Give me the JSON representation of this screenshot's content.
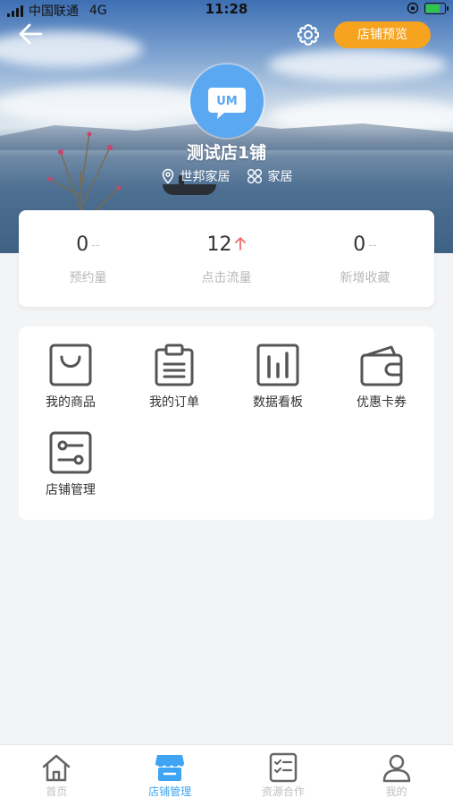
{
  "status_bar": {
    "carrier": "中国联通",
    "network": "4G",
    "time": "11:28",
    "battery_level": 0.85
  },
  "header": {
    "back_icon": "back-arrow-icon",
    "settings_icon": "gear-icon",
    "preview_button_label": "店铺预览",
    "accent_color": "#f6a31f"
  },
  "store": {
    "avatar_text": "UM",
    "name": "测试店1铺",
    "location": "世邦家居",
    "category": "家居"
  },
  "stats": [
    {
      "value": "0",
      "trend": "--",
      "label": "预约量"
    },
    {
      "value": "12",
      "trend": "up",
      "label": "点击流量"
    },
    {
      "value": "0",
      "trend": "--",
      "label": "新增收藏"
    }
  ],
  "menu": {
    "items": [
      {
        "label": "我的商品",
        "icon": "shopping-bag-icon"
      },
      {
        "label": "我的订单",
        "icon": "clipboard-icon"
      },
      {
        "label": "数据看板",
        "icon": "bar-chart-icon"
      },
      {
        "label": "优惠卡券",
        "icon": "wallet-icon"
      },
      {
        "label": "店铺管理",
        "icon": "settings-sliders-icon"
      }
    ]
  },
  "tabbar": {
    "active_color": "#3da5f3",
    "items": [
      {
        "label": "首页",
        "icon": "home-icon",
        "active": false
      },
      {
        "label": "店铺管理",
        "icon": "store-icon",
        "active": true
      },
      {
        "label": "资源合作",
        "icon": "checklist-icon",
        "active": false
      },
      {
        "label": "我的",
        "icon": "user-icon",
        "active": false
      }
    ]
  }
}
